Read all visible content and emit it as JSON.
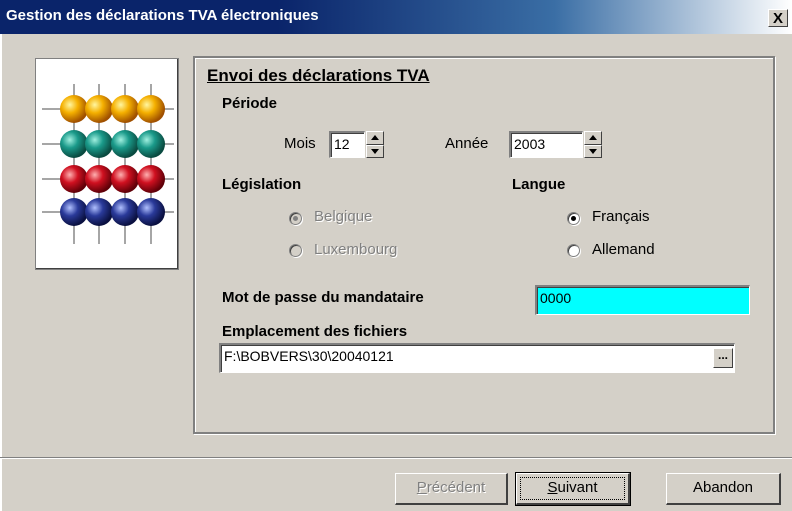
{
  "window": {
    "title": "Gestion des déclarations TVA électroniques",
    "close_label": "X"
  },
  "panel": {
    "section_title": "Envoi des déclarations TVA",
    "periode_label": "Période",
    "mois_label": "Mois",
    "mois_value": "12",
    "annee_label": "Année",
    "annee_value": "2003",
    "legislation_label": "Législation",
    "legislation_options": [
      {
        "label": "Belgique",
        "selected": true,
        "enabled": false
      },
      {
        "label": "Luxembourg",
        "selected": false,
        "enabled": false
      }
    ],
    "langue_label": "Langue",
    "langue_options": [
      {
        "label": "Français",
        "selected": true,
        "enabled": true
      },
      {
        "label": "Allemand",
        "selected": false,
        "enabled": true
      }
    ],
    "password_label": "Mot de passe du mandataire",
    "password_value": "0000",
    "password_bg": "#00ffff",
    "location_label": "Emplacement des fichiers",
    "location_value": "F:\\BOBVERS\\30\\20040121",
    "browse_label": "..."
  },
  "buttons": {
    "previous": {
      "prefix": "",
      "underline": "P",
      "rest": "récédent",
      "enabled": false
    },
    "next": {
      "prefix": "",
      "underline": "S",
      "rest": "uivant",
      "enabled": true
    },
    "cancel": {
      "label": "Abandon",
      "enabled": true
    }
  },
  "logo": {
    "rows": [
      {
        "color": "#f0a000",
        "icon": "yellow-ball"
      },
      {
        "color": "#1a9a8a",
        "icon": "teal-ball"
      },
      {
        "color": "#d01020",
        "icon": "red-ball"
      },
      {
        "color": "#2a3a9a",
        "icon": "blue-ball"
      }
    ]
  },
  "colors": {
    "titlebar_start": "#0a246a",
    "dialog_bg": "#d4d0c8"
  }
}
